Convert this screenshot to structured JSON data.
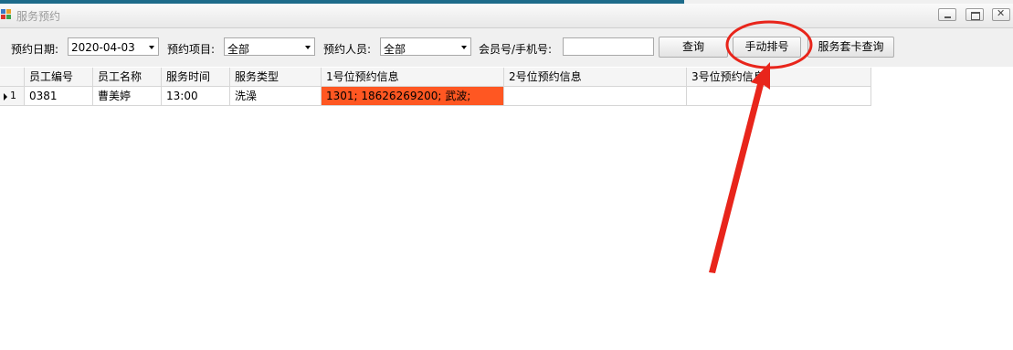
{
  "window": {
    "title": "服务预约"
  },
  "filters": {
    "date_label": "预约日期:",
    "date_value": "2020-04-03",
    "item_label": "预约项目:",
    "item_value": "全部",
    "staff_label": "预约人员:",
    "staff_value": "全部",
    "member_label": "会员号/手机号:",
    "member_value": ""
  },
  "buttons": {
    "query": "查询",
    "manual": "手动排号",
    "card_query": "服务套卡查询"
  },
  "table": {
    "headers": [
      "员工编号",
      "员工名称",
      "服务时间",
      "服务类型",
      "1号位预约信息",
      "2号位预约信息",
      "3号位预约信息"
    ],
    "rows": [
      {
        "row_number": "1",
        "cells": [
          "0381",
          "曹美婷",
          "13:00",
          "洗澡",
          "1301; 18626269200; 武波;",
          "",
          ""
        ]
      }
    ]
  },
  "colors": {
    "highlight_cell": "#ff5722",
    "annotation": "#e8251b"
  }
}
